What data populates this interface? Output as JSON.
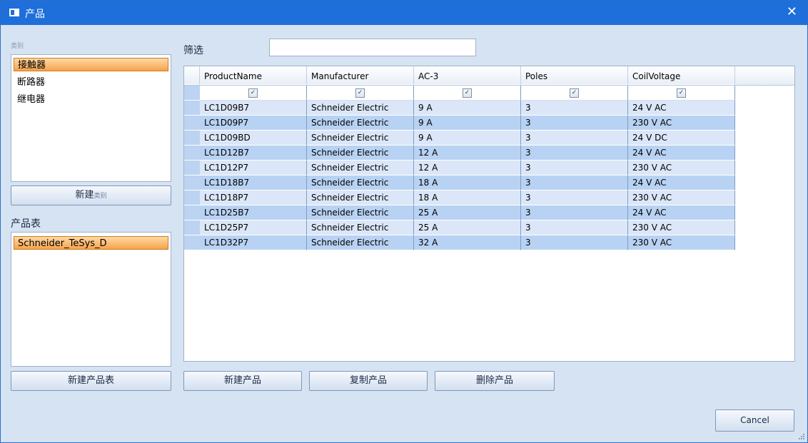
{
  "window": {
    "title": "产品",
    "close_glyph": "✕"
  },
  "category": {
    "section_label": "类别",
    "items": [
      {
        "label": "接触器",
        "selected": true
      },
      {
        "label": "断路器",
        "selected": false
      },
      {
        "label": "继电器",
        "selected": false
      }
    ],
    "new_button": {
      "main": "新建",
      "suffix": "类别"
    }
  },
  "product_table": {
    "section_label": "产品表",
    "items": [
      {
        "label": "Schneider_TeSys_D",
        "selected": true
      }
    ],
    "new_button": "新建产品表"
  },
  "filter": {
    "label": "筛选",
    "value": ""
  },
  "grid": {
    "columns": [
      "ProductName",
      "Manufacturer",
      "AC-3",
      "Poles",
      "CoilVoltage"
    ],
    "filter_checks": [
      true,
      true,
      true,
      true,
      true
    ],
    "rows": [
      [
        "LC1D09B7",
        "Schneider Electric",
        "9 A",
        "3",
        "24 V AC"
      ],
      [
        "LC1D09P7",
        "Schneider Electric",
        "9 A",
        "3",
        "230 V AC"
      ],
      [
        "LC1D09BD",
        "Schneider Electric",
        "9 A",
        "3",
        "24 V DC"
      ],
      [
        "LC1D12B7",
        "Schneider Electric",
        "12 A",
        "3",
        "24 V AC"
      ],
      [
        "LC1D12P7",
        "Schneider Electric",
        "12 A",
        "3",
        "230 V AC"
      ],
      [
        "LC1D18B7",
        "Schneider Electric",
        "18 A",
        "3",
        "24 V AC"
      ],
      [
        "LC1D18P7",
        "Schneider Electric",
        "18 A",
        "3",
        "230 V AC"
      ],
      [
        "LC1D25B7",
        "Schneider Electric",
        "25 A",
        "3",
        "24 V AC"
      ],
      [
        "LC1D25P7",
        "Schneider Electric",
        "25 A",
        "3",
        "230 V AC"
      ],
      [
        "LC1D32P7",
        "Schneider Electric",
        "32 A",
        "3",
        "230 V AC"
      ]
    ]
  },
  "buttons": {
    "new_product": "新建产品",
    "copy_product": "复制产品",
    "delete_product": "删除产品",
    "cancel": "Cancel"
  },
  "colors": {
    "titlebar": "#1e6fd9",
    "selection": "#f7a34a",
    "row_odd": "#dbe7f8",
    "row_even": "#b8d2f3"
  }
}
